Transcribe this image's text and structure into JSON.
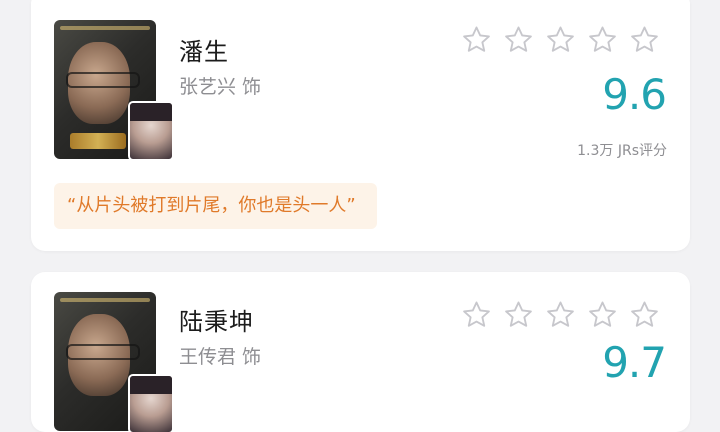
{
  "colors": {
    "score": "#22a3b0",
    "quote_text": "#e07a2a",
    "quote_bg": "#fdf3e8",
    "star_outline": "#c7c7cc"
  },
  "cards": [
    {
      "character_name": "潘生",
      "actor": "张艺兴 饰",
      "stars_filled": 0,
      "stars_total": 5,
      "score": "9.6",
      "rating_count": "1.3万 JRs评分",
      "quote": "“从片头被打到片尾，你也是头一人”"
    },
    {
      "character_name": "陆秉坤",
      "actor": "王传君 饰",
      "stars_filled": 0,
      "stars_total": 5,
      "score": "9.7"
    }
  ]
}
